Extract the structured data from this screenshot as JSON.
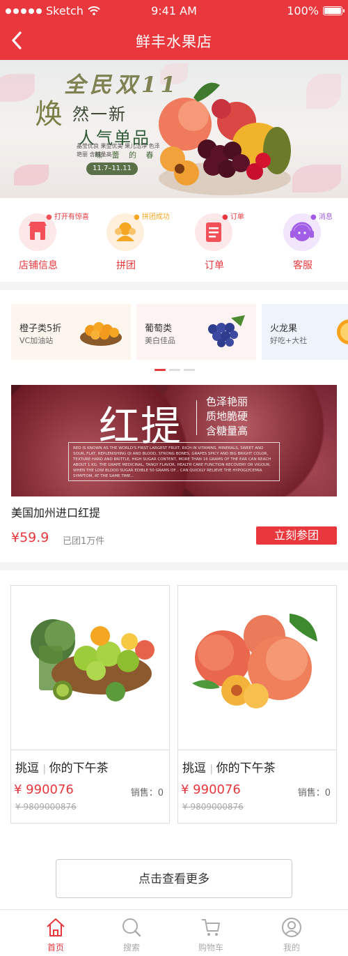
{
  "status_bar": {
    "carrier": "Sketch",
    "time": "9:41 AM",
    "battery": "100%"
  },
  "header": {
    "title": "鲜丰水果店"
  },
  "hero": {
    "headline": "全民双11",
    "line1_big": "焕",
    "line1_rest": "然一新",
    "line2": "人气单品",
    "line3": "味 蕾 的 春 天",
    "tags": "晶莹优良  果型优美  果儿洁净  色泽艳丽  含糖量高",
    "date_range": "11.7–11.11"
  },
  "categories": [
    {
      "label": "店铺信息",
      "badge": "打开有惊喜",
      "icon": "store-icon",
      "color": "#f4505a"
    },
    {
      "label": "拼团",
      "badge": "拼团成功",
      "icon": "group-buy-icon",
      "color": "#f5a623"
    },
    {
      "label": "订单",
      "badge": "订单",
      "icon": "order-icon",
      "color": "#f4505a"
    },
    {
      "label": "客服",
      "badge": "消息",
      "icon": "headset-icon",
      "color": "#a25ee6"
    }
  ],
  "promos": [
    {
      "name": "橙子类5折",
      "sub": "VC加油站"
    },
    {
      "name": "葡萄类",
      "sub": "美白佳品"
    },
    {
      "name": "火龙果",
      "sub": "好吃+大社"
    }
  ],
  "featured": {
    "banner_title": "红提",
    "banner_tags": [
      "色泽艳丽",
      "质地脆硬",
      "含糖量高"
    ],
    "banner_fine_print": "RED IS KNOWN AS THE WORLD'S FIRST LARGEST FRUIT, RICH IN VITAMINS, MINERALS, SWEET AND SOUR, FLAT, REPLENISHING QI AND BLOOD, STRONG BONES, GRAPES SPICY AND BIG BRIGHT COLOR, TEXTURE HARD AND BRITTLE, HIGH SUGAR CONTENT, MORE THAN 16 GRAMS OF THE EAR CAN REACH ABOUT 1 KG. THE GRAPE MEDICINAL, TANGY FLAVOR, HEALTH CARE FUNCTION RECOVERY OR VIGOUR. WHEN THE LOW BLOOD SUGAR EDIBLE 50 GRAMS OF... CAN QUICKLY RELIEVE THE HYPOGLYCEMIA SYMPTOM, AT THE SAME TIME...",
    "name": "美国加州进口红提",
    "price": "¥59.9",
    "sold": "已团1万件",
    "join_label": "立刻参团"
  },
  "products": [
    {
      "title_brand": "挑逗",
      "title_rest": "你的下午茶",
      "price": "¥ 990076",
      "sales": "销售：0",
      "original_price": "¥ 9809000876"
    },
    {
      "title_brand": "挑逗",
      "title_rest": "你的下午茶",
      "price": "¥ 990076",
      "sales": "销售：0",
      "original_price": "¥ 9809000876"
    }
  ],
  "more_label": "点击查看更多",
  "tabs": [
    {
      "label": "首页",
      "icon": "home-icon",
      "active": true
    },
    {
      "label": "搜索",
      "icon": "search-icon",
      "active": false
    },
    {
      "label": "购物车",
      "icon": "cart-icon",
      "active": false
    },
    {
      "label": "我的",
      "icon": "profile-icon",
      "active": false
    }
  ],
  "colors": {
    "brand_red": "#e8383d",
    "inactive_gray": "#aaaaaa"
  }
}
